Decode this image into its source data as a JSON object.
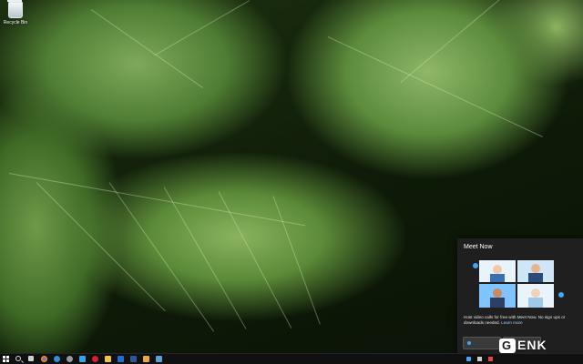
{
  "desktop": {
    "wallpaper": "green-leaves",
    "icons": [
      {
        "label": "Recycle Bin",
        "icon": "recycle-bin-icon"
      }
    ]
  },
  "meet_now": {
    "title": "Meet Now",
    "description": "Host video calls for free with Meet Now. No sign ups or downloads needed.",
    "learn_more": "Learn more",
    "accent": "#3ea6ff"
  },
  "taskbar": {
    "items": [
      "start-icon",
      "search-icon",
      "task-view-icon",
      "chrome-icon",
      "edge-icon",
      "settings-icon",
      "store-icon",
      "opera-icon",
      "explorer-icon",
      "mail-icon",
      "word-icon",
      "files-icon",
      "photos-icon"
    ],
    "tray": [
      "meet-now-icon",
      "network-icon",
      "volume-icon"
    ],
    "clock": {
      "time": "",
      "date": ""
    }
  },
  "watermark": {
    "text": "GENK"
  }
}
